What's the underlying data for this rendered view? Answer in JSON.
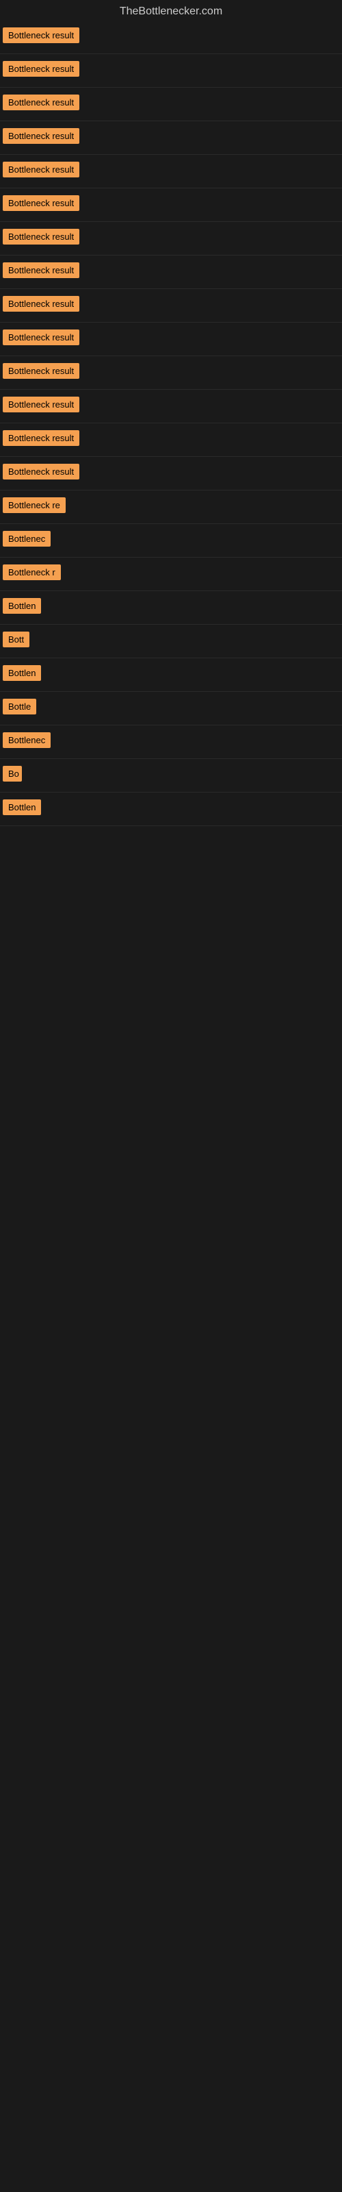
{
  "site": {
    "title": "TheBottlenecker.com"
  },
  "items": [
    {
      "label": "Bottleneck result",
      "width": 130
    },
    {
      "label": "Bottleneck result",
      "width": 130
    },
    {
      "label": "Bottleneck result",
      "width": 130
    },
    {
      "label": "Bottleneck result",
      "width": 130
    },
    {
      "label": "Bottleneck result",
      "width": 130
    },
    {
      "label": "Bottleneck result",
      "width": 130
    },
    {
      "label": "Bottleneck result",
      "width": 130
    },
    {
      "label": "Bottleneck result",
      "width": 130
    },
    {
      "label": "Bottleneck result",
      "width": 130
    },
    {
      "label": "Bottleneck result",
      "width": 130
    },
    {
      "label": "Bottleneck result",
      "width": 130
    },
    {
      "label": "Bottleneck result",
      "width": 130
    },
    {
      "label": "Bottleneck result",
      "width": 130
    },
    {
      "label": "Bottleneck result",
      "width": 130
    },
    {
      "label": "Bottleneck re",
      "width": 106
    },
    {
      "label": "Bottlenec",
      "width": 84
    },
    {
      "label": "Bottleneck r",
      "width": 92
    },
    {
      "label": "Bottlen",
      "width": 68
    },
    {
      "label": "Bott",
      "width": 44
    },
    {
      "label": "Bottlen",
      "width": 68
    },
    {
      "label": "Bottle",
      "width": 55
    },
    {
      "label": "Bottlenec",
      "width": 80
    },
    {
      "label": "Bo",
      "width": 28
    },
    {
      "label": "Bottlen",
      "width": 65
    }
  ]
}
